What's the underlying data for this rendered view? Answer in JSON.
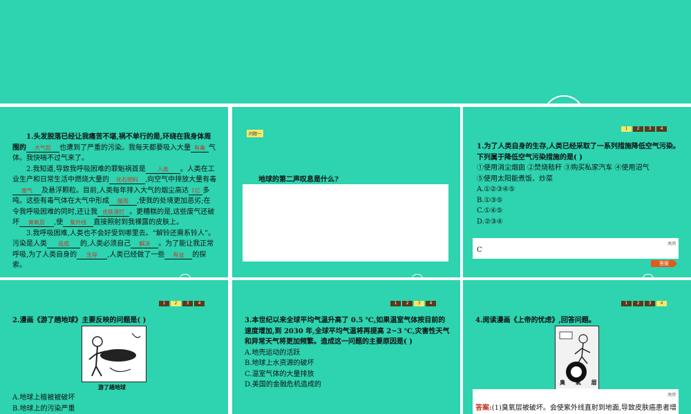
{
  "slide1": {
    "para1_a": "1.头发脱落已经让我痛苦不堪,祸不单行的是,环绕在我身体周围的",
    "blank1": "大气层",
    "para1_b": "也遭到了严重的污染。我每天都要吸入大量",
    "blank2": "有毒",
    "para1_c": "气体。我快喘不过气来了。",
    "para2_a": "2.我知道,导致我呼吸困难的罪魁祸首是",
    "blank3": "人类",
    "para2_b": "。人类在工业生产和日常生活中燃烧大量的",
    "blank4": "化石燃料",
    "para2_c": ",向空气中排放大量有毒",
    "blank5": "废气",
    "para2_d": "及悬浮颗粒。目前,人类每年排入大气的烟尘高达",
    "blank6": "1亿",
    "para2_e": "多吨。这些有毒气体在大气中形成",
    "blank7": "酸雨",
    "para2_f": ",使我的处境更加恶劣;在令我呼吸困难的同时,还让我",
    "blank8": "皮肤溃烂",
    "para2_g": "。更糟糕的是,这些废气还破坏",
    "blank9": "臭氧层",
    "para2_h": ",使",
    "blank10": "紫外线",
    "para2_i": "直接照射到我裸露的皮肤上。",
    "para3_a": "3.我呼吸困难,人类也不会好受到哪里去。“解铃还需系铃人”。污染是人类",
    "blank11": "造成",
    "para3_b": "的,人类必须自己",
    "blank12": "解决",
    "para3_c": "。为了能让我正常呼吸,为了人类自身的",
    "blank13": "生存",
    "para3_d": ",人类已经做了一些",
    "blank14": "有益",
    "para3_e": "的探索。"
  },
  "slide2": {
    "tag": "问题一",
    "question": "地球的第二声叹息是什么?"
  },
  "nav": [
    "1",
    "2",
    "3",
    "4"
  ],
  "slide3": {
    "q": "1.为了人类自身的生存,人类已经采取了一系列措施降低空气污染。下列属于降低空气污染措施的是(      )",
    "opts1": "①使用消尘烟囱   ②焚烧秸秆   ③购买私家汽车   ④使用沼气",
    "opts2": "⑤使用太阳能煮饭、炒菜",
    "a": "A.①②③④⑤",
    "b": "B.①③⑤",
    "c": "C.①④⑤",
    "d": "D.②③④",
    "close": "关闭",
    "answer": "C",
    "answer_button": "答案"
  },
  "slide4": {
    "q": "2.漫画《游了趟地球》主要反映的问题是(      )",
    "caption": "游了趟地球",
    "a": "A.地球上植被被破坏",
    "b": "B.地球上的污染严重"
  },
  "slide5": {
    "q": "3.本世纪以来全球平均气温升高了 0.5 ℃,如果温室气体按目前的速度增加,到 2030 年,全球平均气温将再提高 2~3 ℃,灾害性天气和异常天气将更加频繁。造成这一问题的主要原因是(      )",
    "a": "A.地壳运动的活跃",
    "b": "B.地球上水资源的破坏",
    "c": "C.温室气体的大量排放",
    "d": "D.美国的金融危机造成的"
  },
  "slide6": {
    "q": "4.阅读漫画《上帝的忧虑》,回答问题。",
    "cartoon_text": "臭 氧 层",
    "close": "关闭",
    "answer_label": "答案:",
    "answer_text": "(1)臭氧层被破坏。会使紫外线直射到地面,导致皮肤癌患者增"
  }
}
